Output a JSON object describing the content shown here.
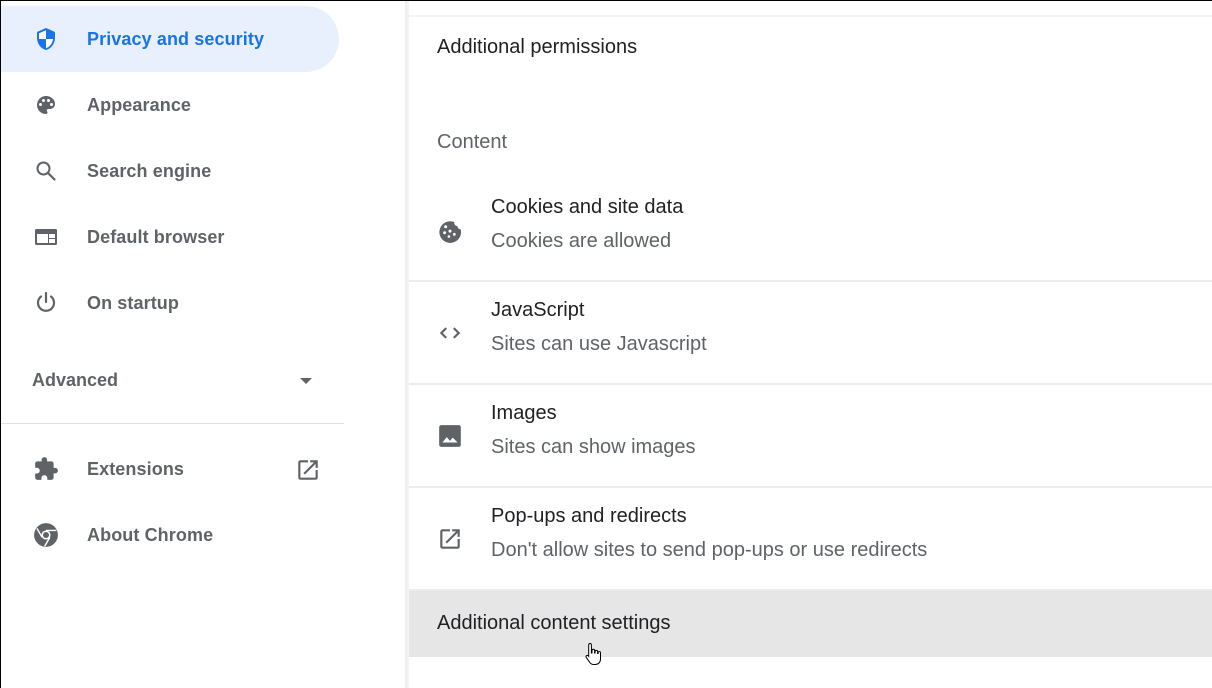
{
  "sidebar": {
    "items": [
      {
        "label": "Privacy and security",
        "icon": "shield-icon",
        "active": true
      },
      {
        "label": "Appearance",
        "icon": "palette-icon"
      },
      {
        "label": "Search engine",
        "icon": "search-icon"
      },
      {
        "label": "Default browser",
        "icon": "browser-icon"
      },
      {
        "label": "On startup",
        "icon": "power-icon"
      }
    ],
    "advanced": {
      "label": "Advanced",
      "icon": "caret-down-icon"
    },
    "bottom_items": [
      {
        "label": "Extensions",
        "icon": "puzzle-icon",
        "trailing_icon": "open-in-new-icon"
      },
      {
        "label": "About Chrome",
        "icon": "chrome-icon"
      }
    ]
  },
  "content": {
    "additional_permissions": "Additional permissions",
    "section_heading": "Content",
    "settings": [
      {
        "title": "Cookies and site data",
        "subtitle": "Cookies are allowed",
        "icon": "cookie-icon"
      },
      {
        "title": "JavaScript",
        "subtitle": "Sites can use Javascript",
        "icon": "code-icon"
      },
      {
        "title": "Images",
        "subtitle": "Sites can show images",
        "icon": "image-icon"
      },
      {
        "title": "Pop-ups and redirects",
        "subtitle": "Don't allow sites to send pop-ups or use redirects",
        "icon": "open-in-new-icon"
      }
    ],
    "additional_content_settings": "Additional content settings"
  },
  "colors": {
    "accent": "#1a73e8",
    "active_bg": "#e8f0fe",
    "icon_gray": "#5f6368",
    "hover_row_bg": "#e6e6e6"
  }
}
